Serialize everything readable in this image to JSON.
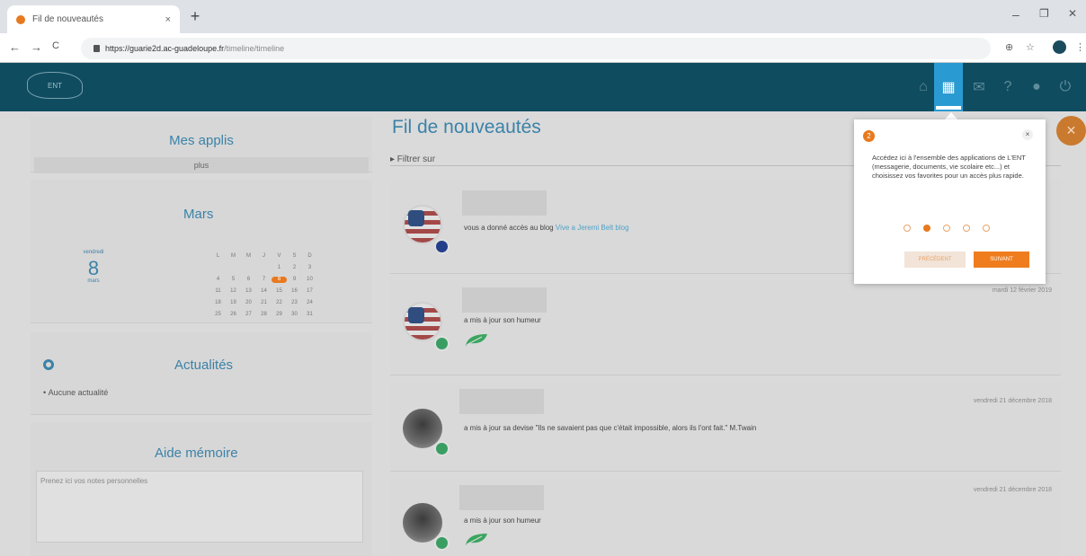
{
  "browser": {
    "tab_title": "Fil de nouveautés",
    "tab_close": "×",
    "new_tab": "+",
    "minimize": "–",
    "restore": "❐",
    "close": "✕",
    "back": "←",
    "forward": "→",
    "reload": "C",
    "url_host": "https://guarie2d.ac-guadeloupe.fr",
    "url_path": "/timeline/timeline",
    "zoom_icon": "⊕",
    "star_icon": "☆",
    "menu_icon": "⋮"
  },
  "header": {
    "logo_text": "ENT",
    "icons": [
      {
        "name": "home-icon",
        "glyph": "⌂"
      },
      {
        "name": "apps-grid-icon",
        "glyph": "▦"
      },
      {
        "name": "mail-icon",
        "glyph": "✉"
      },
      {
        "name": "help-icon",
        "glyph": "?"
      },
      {
        "name": "user-icon",
        "glyph": "●"
      },
      {
        "name": "power-icon",
        "glyph": "⏻"
      }
    ],
    "active_icon_color": "#2a9bd2",
    "bar_color": "#0f4c5f"
  },
  "sidebar": {
    "apps": {
      "title": "Mes applis",
      "plus": "plus"
    },
    "calendar": {
      "month": "Mars",
      "weekday": "vendredi",
      "day": "8",
      "month_small": "mars",
      "grid": [
        "L",
        "M",
        "M",
        "J",
        "V",
        "S",
        "D",
        "",
        "",
        "",
        "",
        "1",
        "2",
        "3",
        "4",
        "5",
        "6",
        "7",
        "8",
        "9",
        "10",
        "11",
        "12",
        "13",
        "14",
        "15",
        "16",
        "17",
        "18",
        "19",
        "20",
        "21",
        "22",
        "23",
        "24",
        "25",
        "26",
        "27",
        "28",
        "29",
        "30",
        "31"
      ],
      "today": "8"
    },
    "news": {
      "title": "Actualités",
      "empty": "Aucune actualité"
    },
    "memo": {
      "title": "Aide mémoire",
      "placeholder": "Prenez ici vos notes personnelles"
    }
  },
  "feed": {
    "title": "Fil de nouveautés",
    "filter": "▸ Filtrer sur",
    "items": [
      {
        "text": "vous a donné accès au blog",
        "link": "Vive a Jeremi Belt blog",
        "date": ""
      },
      {
        "text": "a mis à jour son humeur",
        "link": "",
        "date": "mardi 12 février 2019"
      },
      {
        "text": "a mis à jour sa devise \"Ils ne savaient pas que c'était impossible, alors ils l'ont fait.\" M.Twain",
        "link": "",
        "date": "vendredi 21 décembre 2018"
      },
      {
        "text": "a mis à jour son humeur",
        "link": "",
        "date": "vendredi 21 décembre 2018"
      }
    ]
  },
  "tour": {
    "step": "2",
    "close": "×",
    "text": "Accédez ici à l'ensemble des applications de L'ENT (messagerie, documents, vie scolaire etc...) et choisissez vos favorites pour un accès plus rapide.",
    "dots": 5,
    "active_dot": 1,
    "prev_label": "PRÉCÉDENT",
    "next_label": "SUIVANT",
    "accent": "#ef7d1e"
  },
  "fab": {
    "glyph": "✕"
  }
}
